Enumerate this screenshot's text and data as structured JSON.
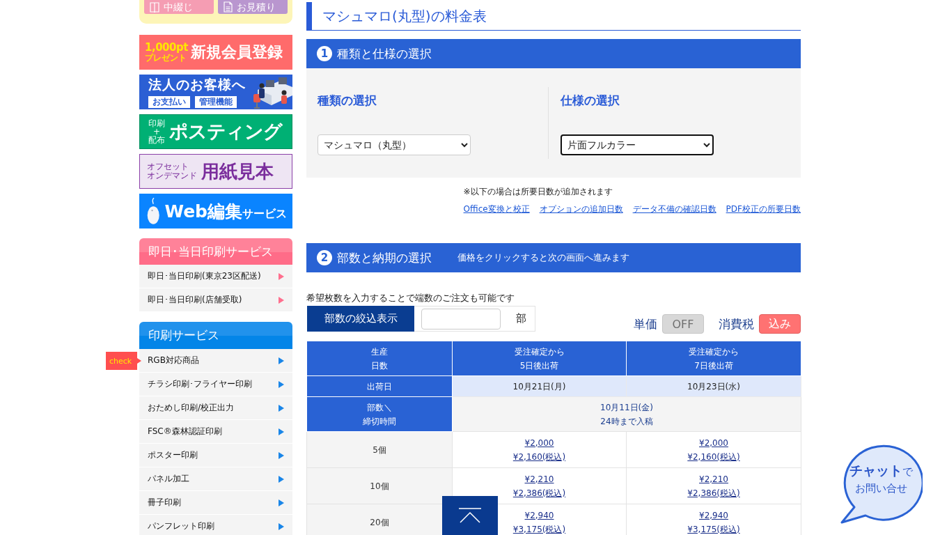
{
  "top_buttons": [
    {
      "kind": "saddle",
      "label": "中綴じ"
    },
    {
      "kind": "estimate",
      "label": "お見積り"
    }
  ],
  "banners": [
    {
      "kind": "signup",
      "small_lines": [
        "1,000pt",
        "プレゼント"
      ],
      "title": "新規会員登録"
    },
    {
      "kind": "corporate",
      "title": "法人のお客様へ",
      "tags": [
        "お支払い",
        "管理機能"
      ]
    },
    {
      "kind": "posting",
      "small_lines": [
        "印刷",
        "+",
        "配布"
      ],
      "title": "ポスティング"
    },
    {
      "kind": "paper",
      "small_lines": [
        "オフセット",
        "オンデマンド"
      ],
      "title": "用紙見本"
    },
    {
      "kind": "web",
      "title": "Web編集",
      "suffix": "サービス"
    }
  ],
  "side_menus": [
    {
      "kind": "sameday",
      "title": "即日･当日印刷サービス",
      "items": [
        {
          "label": "即日･当日印刷(東京23区配送)"
        },
        {
          "label": "即日･当日印刷(店舗受取)"
        }
      ]
    },
    {
      "kind": "printing",
      "title": "印刷サービス",
      "items": [
        {
          "label": "RGB対応商品",
          "tag": "check"
        },
        {
          "label": "チラシ印刷･フライヤー印刷"
        },
        {
          "label": "おためし印刷/校正出力"
        },
        {
          "label": "FSC®森林認証印刷"
        },
        {
          "label": "ポスター印刷"
        },
        {
          "label": "パネル加工"
        },
        {
          "label": "冊子印刷"
        },
        {
          "label": "パンフレット印刷"
        }
      ]
    }
  ],
  "page_title": "マシュマロ(丸型)の料金表",
  "step_1": {
    "number": "1",
    "title": "種類と仕様の選択",
    "selects": [
      {
        "label": "種類の選択",
        "value": "マシュマロ（丸型）",
        "focused": false
      },
      {
        "label": "仕様の選択",
        "value": "片面フルカラー",
        "focused": true
      }
    ],
    "note": "※以下の場合は所要日数が追加されます",
    "links": [
      "Office変換と校正",
      "オプションの追加日数",
      "データ不備の確認日数",
      "PDF校正の所要日数"
    ]
  },
  "step_2": {
    "number": "2",
    "title": "部数と納期の選択",
    "subtitle": "価格をクリックすると次の画面へ進みます",
    "hint": "希望枚数を入力することで端数のご注文も可能です",
    "filter_button": "部数の絞込表示",
    "unit": "部",
    "toggles": [
      {
        "label": "単価",
        "value": "OFF",
        "on": false
      },
      {
        "label": "消費税",
        "value": "込み",
        "on": true
      }
    ]
  },
  "price_table": {
    "columns": [
      [
        "生産",
        "日数"
      ],
      [
        "受注確定から",
        "5日後出荷"
      ],
      [
        "受注確定から",
        "7日後出荷"
      ]
    ],
    "ship_label": "出荷日",
    "ship_dates": [
      "10月21日(月)",
      "10月23日(水)"
    ],
    "deadline_label": [
      "部数＼",
      "締切時間"
    ],
    "deadline": [
      "10月11日(金)",
      "24時まで入稿"
    ],
    "rows": [
      {
        "quantity": "5個",
        "prices": [
          {
            "price": "¥2,000",
            "with_tax": "¥2,160(税込)"
          },
          {
            "price": "¥2,000",
            "with_tax": "¥2,160(税込)"
          }
        ]
      },
      {
        "quantity": "10個",
        "prices": [
          {
            "price": "¥2,210",
            "with_tax": "¥2,386(税込)"
          },
          {
            "price": "¥2,210",
            "with_tax": "¥2,386(税込)"
          }
        ]
      },
      {
        "quantity": "20個",
        "prices": [
          {
            "price": "¥2,940",
            "with_tax": "¥3,175(税込)"
          },
          {
            "price": "¥2,940",
            "with_tax": "¥3,175(税込)"
          }
        ]
      }
    ]
  },
  "chat_button": {
    "lines": [
      "**チャット**で",
      "お問い合せ"
    ]
  }
}
